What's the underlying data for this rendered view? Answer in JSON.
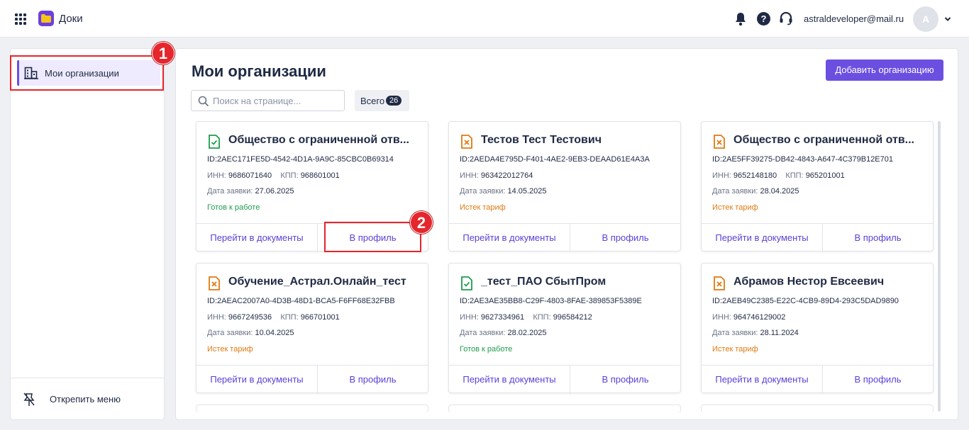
{
  "app": {
    "title": "Доки"
  },
  "header": {
    "user_email": "astraldeveloper@mail.ru",
    "avatar_letter": "A"
  },
  "sidebar": {
    "items": [
      {
        "label": "Мои организации"
      }
    ],
    "unpin_label": "Открепить меню"
  },
  "annotations": [
    "1",
    "2"
  ],
  "main": {
    "title": "Мои организации",
    "add_button": "Добавить организацию",
    "search_placeholder": "Поиск на странице...",
    "total_label": "Всего",
    "total_count": "26",
    "field_labels": {
      "inn": "ИНН:",
      "kpp": "КПП:",
      "date": "Дата заявки:"
    },
    "actions": {
      "docs": "Перейти в документы",
      "profile": "В профиль"
    },
    "cards": [
      {
        "name": "Общество с ограниченной отв...",
        "id": "ID:2AEC171FE5D-4542-4D1A-9A9C-85CBC0B69314",
        "inn": "9686071640",
        "kpp": "968601001",
        "date": "27.06.2025",
        "status": "Готов к работе",
        "status_kind": "ok"
      },
      {
        "name": "Тестов Тест Тестович",
        "id": "ID:2AEDA4E795D-F401-4AE2-9EB3-DEAAD61E4A3A",
        "inn": "963422012764",
        "kpp": "",
        "date": "14.05.2025",
        "status": "Истек тариф",
        "status_kind": "expired"
      },
      {
        "name": "Общество с ограниченной отв...",
        "id": "ID:2AE5FF39275-DB42-4843-A647-4C379B12E701",
        "inn": "9652148180",
        "kpp": "965201001",
        "date": "28.04.2025",
        "status": "Истек тариф",
        "status_kind": "expired"
      },
      {
        "name": "Обучение_Астрал.Онлайн_тест",
        "id": "ID:2AEAC2007A0-4D3B-48D1-BCA5-F6FF68E32FBB",
        "inn": "9667249536",
        "kpp": "966701001",
        "date": "10.04.2025",
        "status": "Истек тариф",
        "status_kind": "expired"
      },
      {
        "name": "_тест_ПАО СбытПром",
        "id": "ID:2AE3AE35BB8-C29F-4803-8FAE-389853F5389E",
        "inn": "9627334961",
        "kpp": "996584212",
        "date": "28.02.2025",
        "status": "Готов к работе",
        "status_kind": "ok"
      },
      {
        "name": "Абрамов Нестор Евсеевич",
        "id": "ID:2AEB49C2385-E22C-4CB9-89D4-293C5DAD9890",
        "inn": "964746129002",
        "kpp": "",
        "date": "28.11.2024",
        "status": "Истек тариф",
        "status_kind": "expired"
      }
    ]
  },
  "colors": {
    "accent": "#6b4fe0",
    "ok": "#1f9d4c",
    "expired": "#e07a12",
    "annotation": "#e5262c"
  }
}
